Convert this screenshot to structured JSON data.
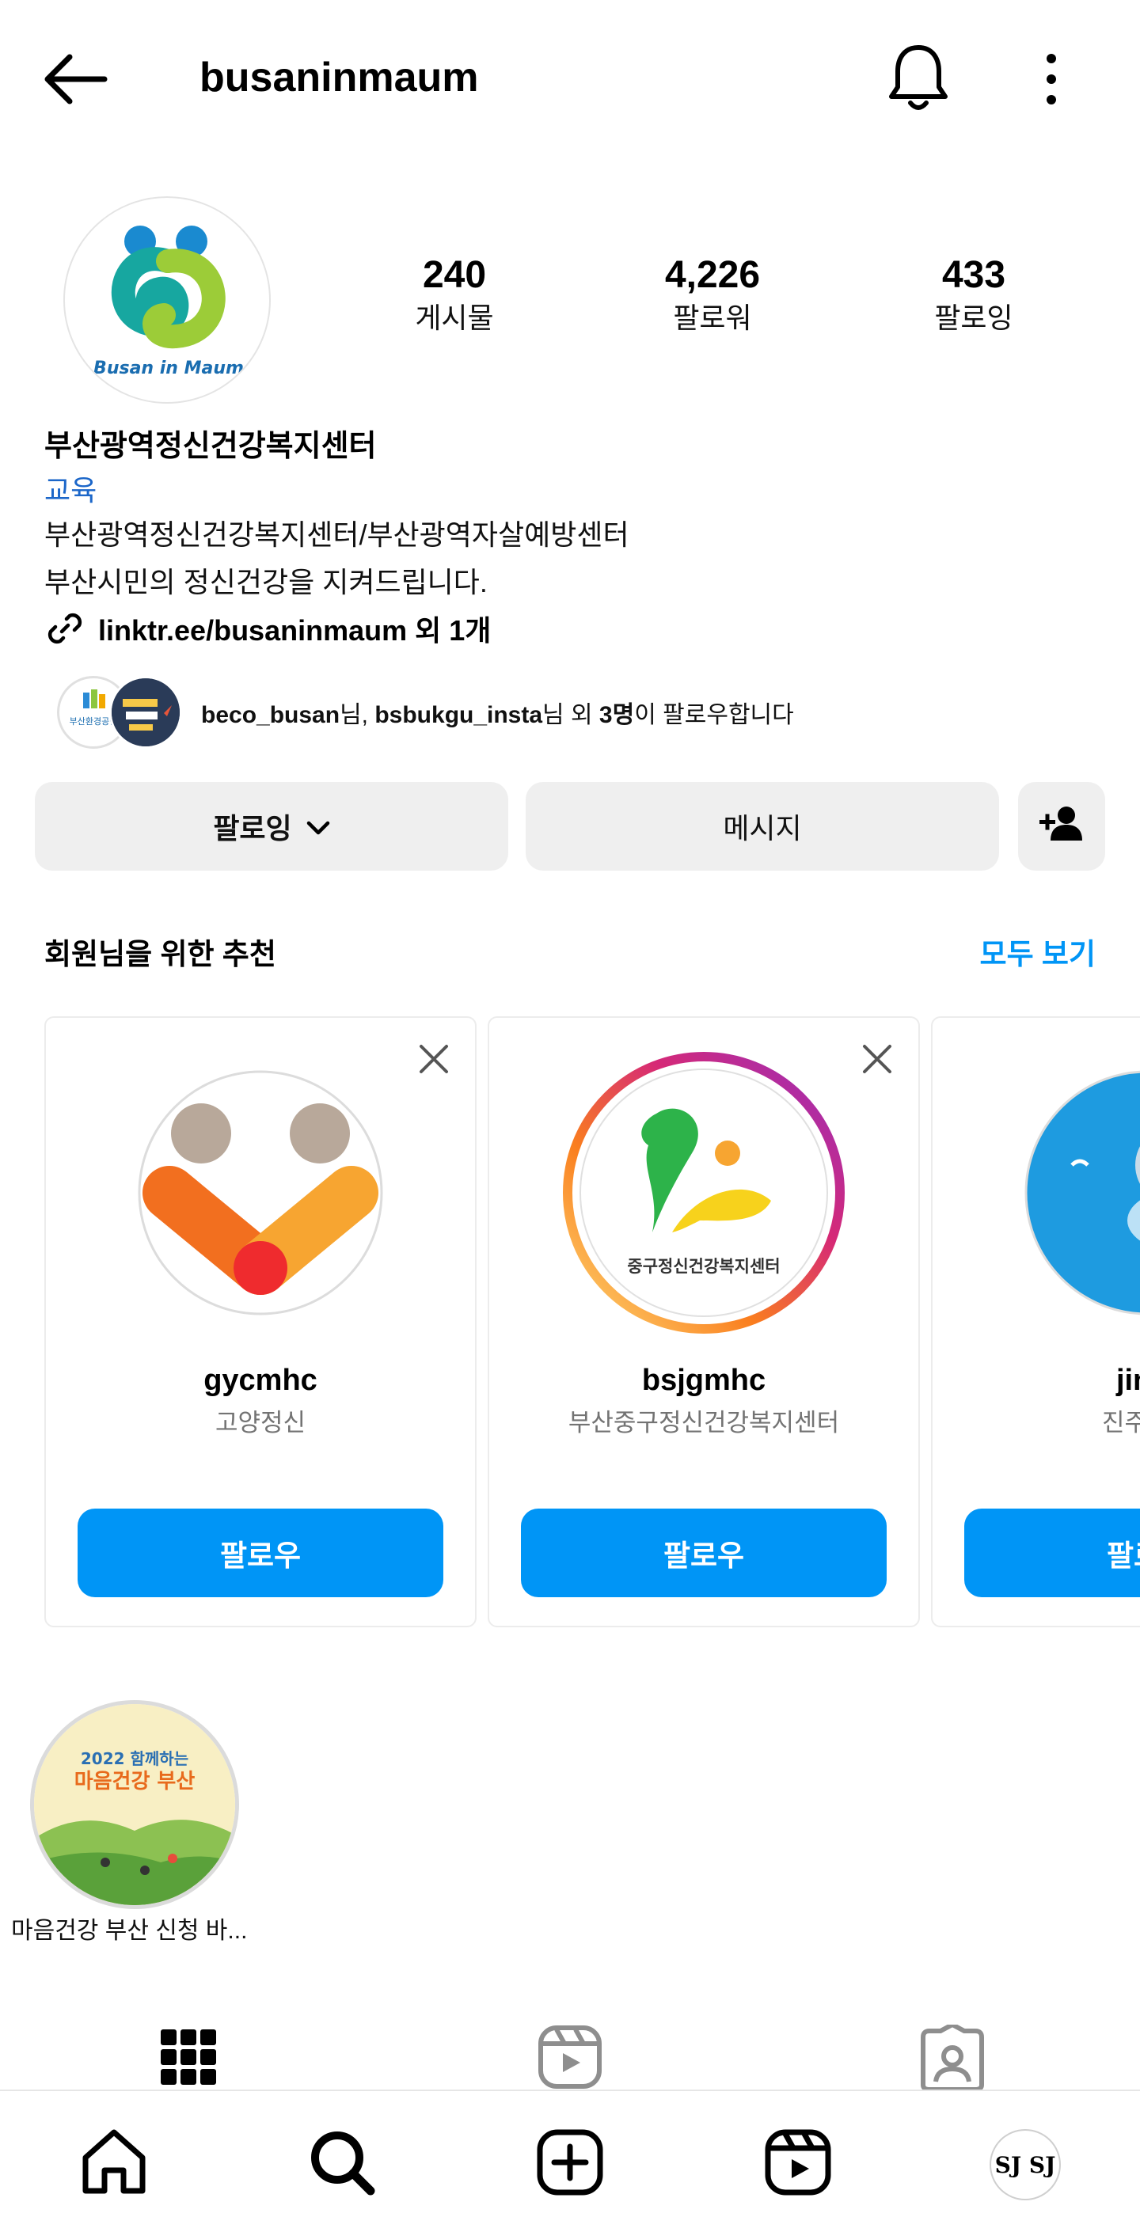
{
  "header": {
    "username": "busaninmaum",
    "icons": [
      "back-arrow-icon",
      "bell-icon",
      "more-vertical-icon"
    ]
  },
  "profile": {
    "avatar_text": "Busan in Maum",
    "stats": [
      {
        "value": "240",
        "label": "게시물"
      },
      {
        "value": "4,226",
        "label": "팔로워"
      },
      {
        "value": "433",
        "label": "팔로잉"
      }
    ],
    "display_name": "부산광역정신건강복지센터",
    "category": "교육",
    "bio_line1": "부산광역정신건강복지센터/부산광역자살예방센터",
    "bio_line2": "부산시민의 정신건강을 지켜드립니다.",
    "link": "linktr.ee/busaninmaum 외 1개"
  },
  "followed_by": {
    "user1": "beco_busan",
    "sep1": "님, ",
    "user2": "bsbukgu_insta",
    "sep2": "님 외 ",
    "others": "3명",
    "suffix": "이 팔로우합니다",
    "mini1_text": "부산환경공단"
  },
  "actions": {
    "following_label": "팔로잉",
    "message_label": "메시지"
  },
  "suggestions": {
    "title": "회원님을 위한 추천",
    "see_all": "모두 보기",
    "cards": [
      {
        "username": "gycmhc",
        "subtitle": "고양정신",
        "button": "팔로우"
      },
      {
        "username": "bsjgmhc",
        "subtitle": "부산중구정신건강복지센터",
        "button": "팔로우",
        "logo_text": "중구정신건강복지센터"
      },
      {
        "username": "jinju",
        "subtitle": "진주관광",
        "button": "팔로우"
      }
    ]
  },
  "highlights": [
    {
      "label": "마음건강 부산 신청 바...",
      "cover_line1": "2022 함께하는",
      "cover_line2": "마음건강 부산"
    }
  ],
  "bottom_nav": {
    "avatar_text": "SJ SJ",
    "icons": [
      "home-icon",
      "search-icon",
      "create-icon",
      "reels-icon"
    ]
  },
  "colors": {
    "accent": "#0095f6",
    "link": "#1b66c9",
    "button_gray": "#efefef",
    "subtitle_gray": "#737373"
  }
}
